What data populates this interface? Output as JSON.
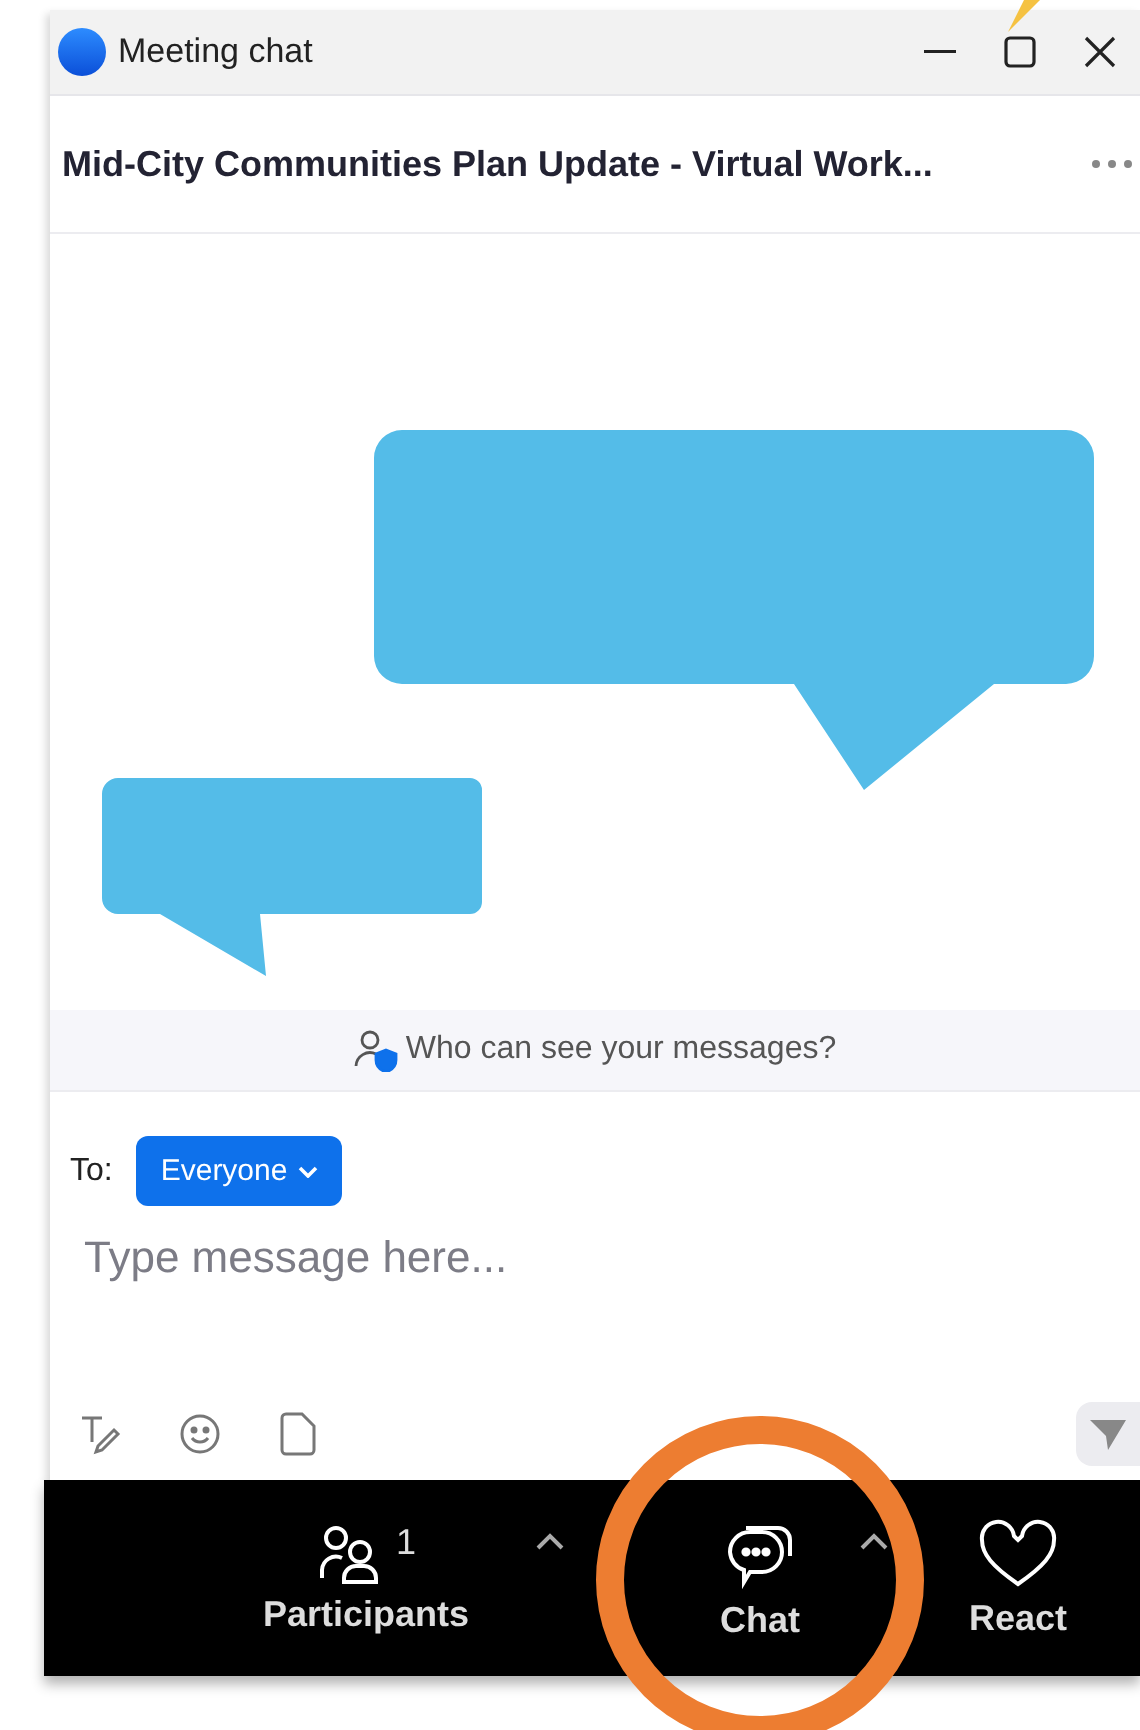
{
  "window": {
    "title": "Meeting chat"
  },
  "header": {
    "title": "Mid-City Communities Plan Update - Virtual Work..."
  },
  "banner": {
    "text": "Who can see your messages?"
  },
  "composer": {
    "to_label": "To:",
    "recipient": "Everyone",
    "placeholder": "Type message here..."
  },
  "toolbar": [
    {
      "kind": "participants",
      "label": "Participants",
      "count": "1",
      "menu": true,
      "highlighted": false
    },
    {
      "kind": "chat",
      "label": "Chat",
      "menu": true,
      "highlighted": true
    },
    {
      "kind": "react",
      "label": "React",
      "menu": false,
      "highlighted": false
    }
  ]
}
